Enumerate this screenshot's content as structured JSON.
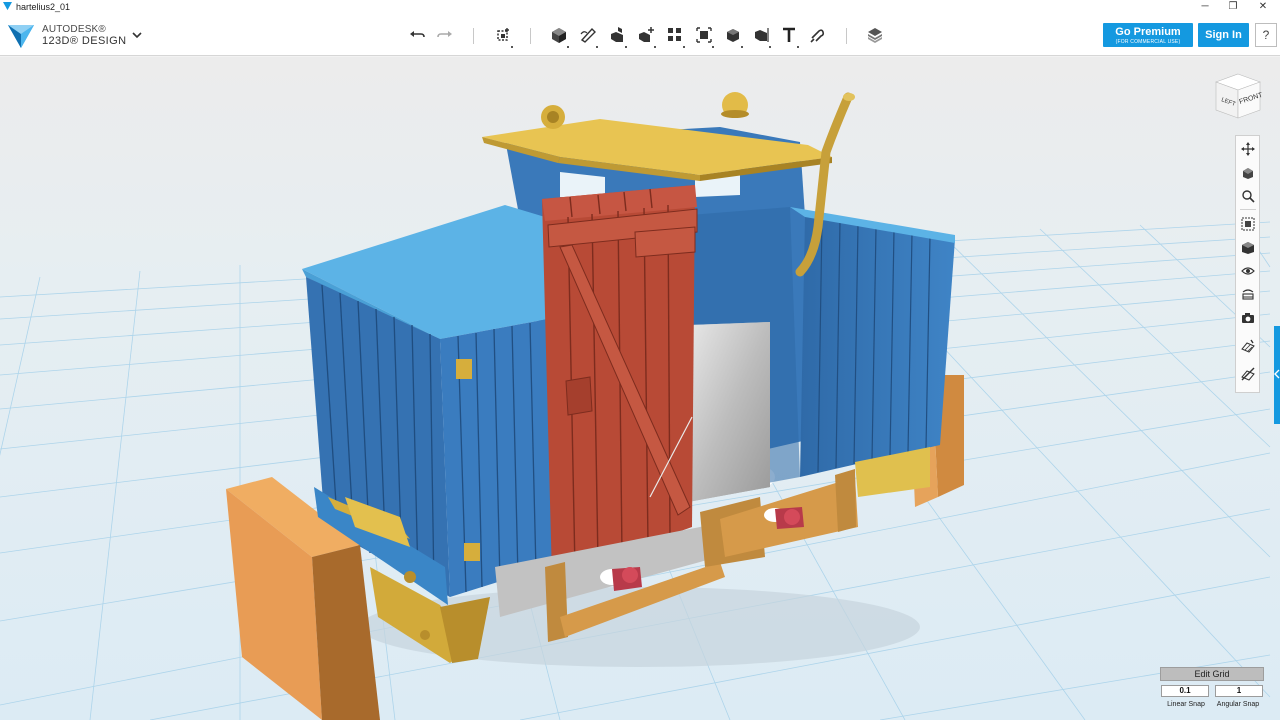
{
  "window": {
    "title": "hartelius2_01",
    "minimize_glyph": "─",
    "maximize_glyph": "❐",
    "close_glyph": "✕"
  },
  "brand": {
    "line1": "AUTODESK®",
    "line2": "123D® DESIGN",
    "accent_color": "#1499e0"
  },
  "toolbar": {
    "tools": [
      {
        "name": "undo-icon"
      },
      {
        "name": "redo-icon"
      },
      {
        "name": "transform-icon"
      },
      {
        "name": "primitives-icon"
      },
      {
        "name": "sketch-icon"
      },
      {
        "name": "construct-icon"
      },
      {
        "name": "modify-icon"
      },
      {
        "name": "pattern-icon"
      },
      {
        "name": "grouping-icon"
      },
      {
        "name": "combine-icon"
      },
      {
        "name": "measure-icon"
      },
      {
        "name": "text-icon"
      },
      {
        "name": "snap-icon"
      },
      {
        "name": "material-icon"
      }
    ]
  },
  "account": {
    "premium_label": "Go Premium",
    "premium_sub": "(FOR COMMERCIAL USE)",
    "signin_label": "Sign In",
    "help_label": "?"
  },
  "viewcube": {
    "left_label": "LEFT",
    "front_label": "FRONT"
  },
  "nav": [
    {
      "name": "pan-icon"
    },
    {
      "name": "orbit-icon"
    },
    {
      "name": "zoom-icon"
    },
    {
      "name": "fit-icon"
    },
    {
      "name": "view-mode-icon"
    },
    {
      "name": "visibility-icon"
    },
    {
      "name": "materials-visibility-icon"
    },
    {
      "name": "screenshot-icon"
    },
    {
      "name": "grid-toggle-icon"
    },
    {
      "name": "hide-grid-icon"
    }
  ],
  "grid": {
    "title": "Edit Grid",
    "linear_value": "0.1",
    "angular_value": "1",
    "linear_label": "Linear Snap",
    "angular_label": "Angular Snap"
  },
  "colors": {
    "body_blue": "#3b7bbd",
    "roof_blue": "#5cb3e6",
    "door_red": "#b84a36",
    "roof_yellow": "#e6c04e",
    "bumper_orange": "#e89c55",
    "frame_tan": "#c08a3e",
    "grid_line": "#a8d2ea"
  }
}
